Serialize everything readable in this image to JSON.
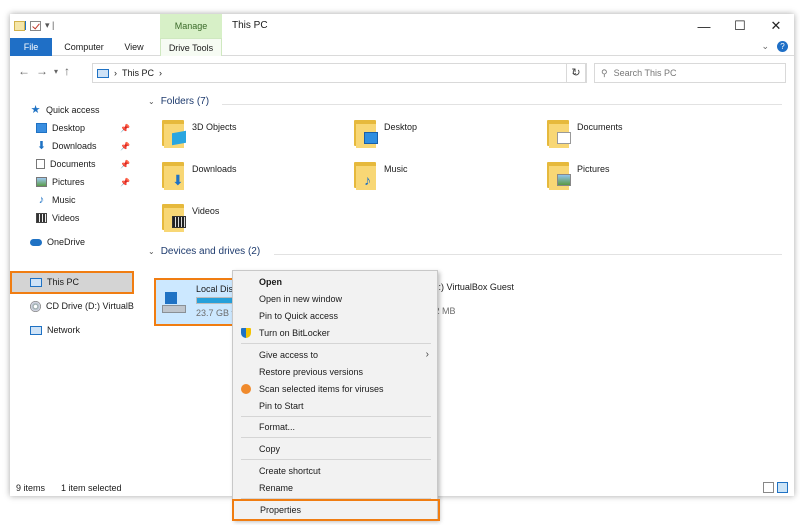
{
  "window": {
    "title": "This PC",
    "manage_tab": "Manage"
  },
  "ribbon": {
    "file": "File",
    "computer": "Computer",
    "view": "View",
    "drive_tools": "Drive Tools",
    "help": "?"
  },
  "address": {
    "path": "This PC",
    "search_placeholder": "Search This PC"
  },
  "sidebar": {
    "quick_access": "Quick access",
    "items": [
      {
        "label": "Desktop",
        "icon": "desktop-icon"
      },
      {
        "label": "Downloads",
        "icon": "downloads-icon"
      },
      {
        "label": "Documents",
        "icon": "documents-icon"
      },
      {
        "label": "Pictures",
        "icon": "pictures-icon"
      },
      {
        "label": "Music",
        "icon": "music-icon"
      },
      {
        "label": "Videos",
        "icon": "videos-icon"
      }
    ],
    "onedrive": "OneDrive",
    "this_pc": "This PC",
    "cd_drive": "CD Drive (D:) VirtualB",
    "network": "Network"
  },
  "folders": {
    "header": "Folders (7)",
    "items": [
      {
        "name": "3D Objects"
      },
      {
        "name": "Desktop"
      },
      {
        "name": "Documents"
      },
      {
        "name": "Downloads"
      },
      {
        "name": "Music"
      },
      {
        "name": "Pictures"
      },
      {
        "name": "Videos"
      }
    ]
  },
  "devices": {
    "header": "Devices and drives (2)",
    "local_disk": {
      "name": "Local Disk (C:)",
      "free": "23.7 GB free",
      "used_fraction": 0.6
    },
    "cd_drive": {
      "name": "CD Drive (D:) VirtualBox Guest",
      "free": "58.2 MB"
    }
  },
  "status": {
    "items": "9 items",
    "selected": "1 item selected"
  },
  "context_menu": {
    "open": "Open",
    "open_new_window": "Open in new window",
    "pin_quick": "Pin to Quick access",
    "bitlocker": "Turn on BitLocker",
    "give_access": "Give access to",
    "restore": "Restore previous versions",
    "scan": "Scan selected items for viruses",
    "pin_start": "Pin to Start",
    "format": "Format...",
    "copy": "Copy",
    "shortcut": "Create shortcut",
    "rename": "Rename",
    "properties": "Properties"
  }
}
